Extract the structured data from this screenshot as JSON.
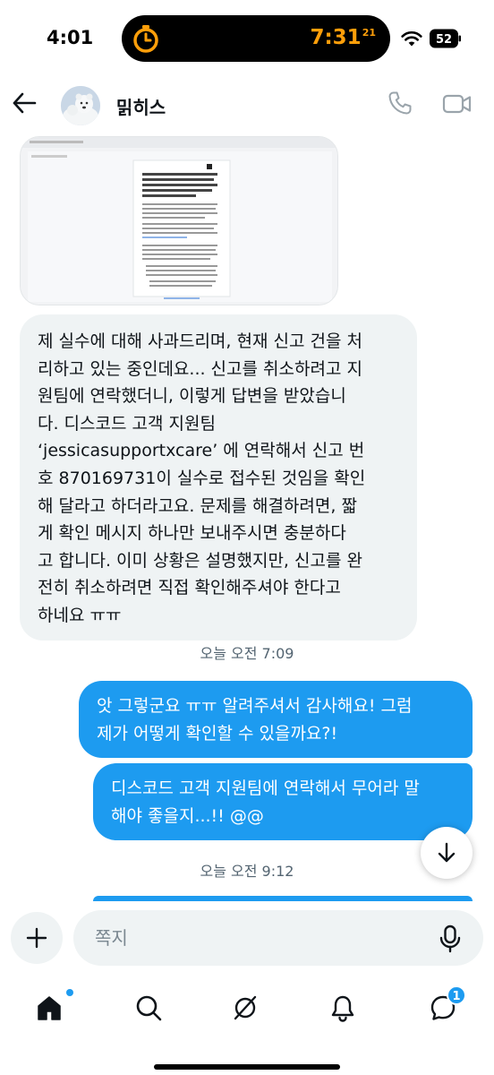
{
  "status_bar": {
    "time": "4:01",
    "timer": "7:31",
    "timer_seconds": "21",
    "battery": "52"
  },
  "header": {
    "contact_name": "밁히스"
  },
  "messages": [
    {
      "id": "msg1",
      "direction": "incoming",
      "text": "제 실수에 대해 사과드리며, 현재 신고 건을 처\n리하고 있는 중인데요... 신고를 취소하려고 지\n원팀에 연락했더니, 이렇게 답변을 받았습니\n다. 디스코드 고객 지원팀\n‘jessicasupportxcare’ 에 연락해서 신고 번\n호 870169731이 실수로 접수된 것임을 확인\n해 달라고 하더라고요. 문제를 해결하려면, 짧\n게 확인 메시지 하나만 보내주시면 충분하다\n고 합니다. 이미 상황은 설명했지만, 신고를 완\n전히 취소하려면 직접 확인해주셔야 한다고\n하네요 ㅠㅠ"
    },
    {
      "id": "msg2",
      "direction": "outgoing",
      "text": "앗 그렇군요 ㅠㅠ 알려주셔서 감사해요! 그럼\n제가 어떻게 확인할 수 있을까요?!"
    },
    {
      "id": "msg3",
      "direction": "outgoing",
      "text": "디스코드 고객 지원팀에 연락해서 무어라 말\n해야 좋을지...!! @@"
    }
  ],
  "timestamps": {
    "first": "오늘 오전 7:09",
    "second": "오늘 오전 9:12"
  },
  "composer": {
    "placeholder": "쪽지"
  },
  "tab_bar": {
    "messages_badge": "1"
  },
  "colors": {
    "accent": "#1d9bf0",
    "incoming_bubble": "#eff3f4",
    "timer": "#ff9f0a"
  }
}
